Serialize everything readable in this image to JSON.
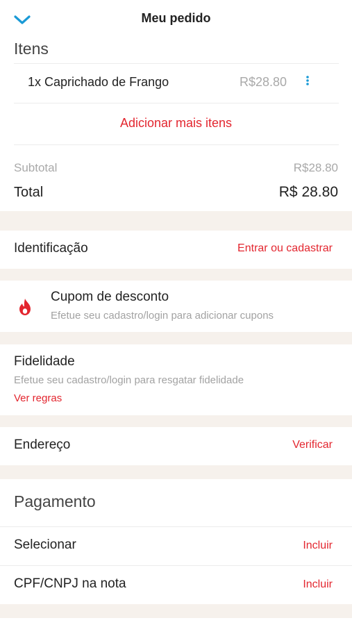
{
  "header": {
    "title": "Meu pedido",
    "back_icon": "chevron-down-icon"
  },
  "items_section": {
    "title": "Itens",
    "items": [
      {
        "name": "1x Caprichado de Frango",
        "price": "R$28.80"
      }
    ],
    "add_more": "Adicionar mais itens"
  },
  "totals": {
    "subtotal_label": "Subtotal",
    "subtotal_value": "R$28.80",
    "total_label": "Total",
    "total_value": "R$ 28.80"
  },
  "identification": {
    "label": "Identificação",
    "action": "Entrar ou cadastrar"
  },
  "coupon": {
    "title": "Cupom de desconto",
    "subtitle": "Efetue seu cadastro/login para adicionar cupons",
    "icon": "flame-icon"
  },
  "loyalty": {
    "title": "Fidelidade",
    "subtitle": "Efetue seu cadastro/login para resgatar fidelidade",
    "link": "Ver regras"
  },
  "address": {
    "label": "Endereço",
    "action": "Verificar"
  },
  "payment": {
    "title": "Pagamento",
    "select_label": "Selecionar",
    "select_action": "Incluir",
    "cpf_label": "CPF/CNPJ na nota",
    "cpf_action": "Incluir"
  },
  "colors": {
    "accent_red": "#e3262f",
    "accent_blue": "#1a9ad6",
    "separator": "#f6f1ec"
  }
}
